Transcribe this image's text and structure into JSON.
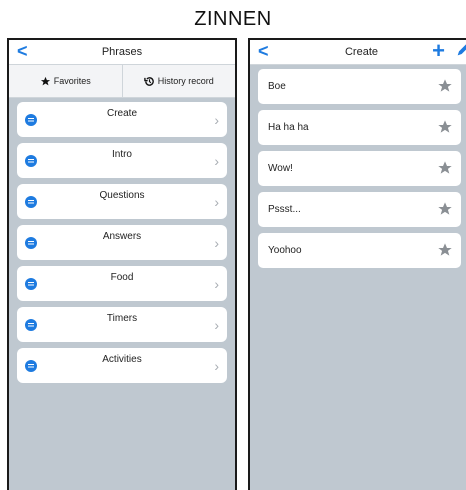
{
  "page": {
    "title": "ZINNEN"
  },
  "left": {
    "nav": {
      "back": "<",
      "title": "Phrases"
    },
    "tabs": {
      "favorites": "Favorites",
      "history": "History record"
    },
    "categories": [
      "Create",
      "Intro",
      "Questions",
      "Answers",
      "Food",
      "Timers",
      "Activities"
    ]
  },
  "right": {
    "nav": {
      "back": "<",
      "title": "Create",
      "add": "+"
    },
    "phrases": [
      "Boe",
      "Ha ha ha",
      "Wow!",
      "Pssst...",
      "Yoohoo"
    ]
  },
  "colors": {
    "accent": "#1e7be0",
    "panel_bg": "#bfc8d0",
    "star": "#8a8f94"
  },
  "icons": {
    "back": "chevron-left-icon",
    "add": "plus-icon",
    "edit": "pencil-icon",
    "favorite": "star-icon",
    "history": "history-icon",
    "category": "chat-bubble-icon"
  }
}
